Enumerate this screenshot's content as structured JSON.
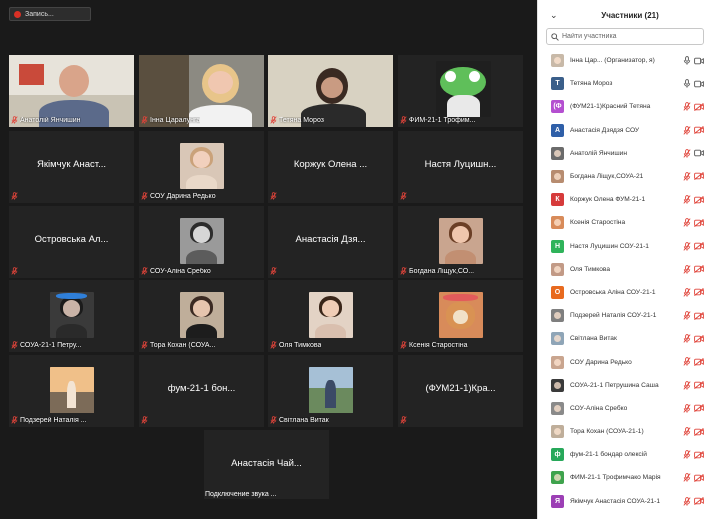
{
  "recording": {
    "label": "Запись..."
  },
  "tiles": [
    {
      "name": "Анатолій Янчишин",
      "center": "",
      "photo": "man",
      "bg": "#c9c3b4"
    },
    {
      "name": "Інна Царалунга",
      "center": "",
      "photo": "woman-blonde",
      "bg": "#8c8a82"
    },
    {
      "name": "Тетяна Мороз",
      "center": "",
      "photo": "woman-dark",
      "bg": "#b7b2a6",
      "active": true
    },
    {
      "name": "ФИМ-21-1 Трофим...",
      "center": "",
      "photo": "frog",
      "bg": "#1f1f1f"
    },
    {
      "name": "",
      "center": "Якімчук Анаст...",
      "photo": ""
    },
    {
      "name": "СОУ Дарина Редько",
      "center": "",
      "photo": "girl-light",
      "bg": "#d9c7b7"
    },
    {
      "name": "",
      "center": "Коржук Олена ...",
      "photo": ""
    },
    {
      "name": "",
      "center": "Настя Луцишн...",
      "photo": ""
    },
    {
      "name": "",
      "center": "Островська Ал...",
      "photo": ""
    },
    {
      "name": "СОУ-Аліна Сребко",
      "center": "",
      "photo": "girl-bw",
      "bg": "#9a9a9a"
    },
    {
      "name": "",
      "center": "Анастасія Дзя...",
      "photo": ""
    },
    {
      "name": "Богдана Ліщук,СО...",
      "center": "",
      "photo": "girl-brown",
      "bg": "#c9a58f"
    },
    {
      "name": "СОУА-21-1 Петру...",
      "center": "",
      "photo": "girl-crown",
      "bg": "#3a3a3a"
    },
    {
      "name": "Тора Кохан (СОУА...",
      "center": "",
      "photo": "girl-room",
      "bg": "#bfae9a"
    },
    {
      "name": "Оля Тимкова",
      "center": "",
      "photo": "girl-dark",
      "bg": "#e3d3c5"
    },
    {
      "name": "Ксенія Старостіна",
      "center": "",
      "photo": "dog",
      "bg": "#d88b5a"
    },
    {
      "name": "Подзерей Наталія ...",
      "center": "",
      "photo": "sunset",
      "bg": "#e2b07d"
    },
    {
      "name": "",
      "center": "фум-21-1 бон...",
      "photo": ""
    },
    {
      "name": "Світлана Витак",
      "center": "",
      "photo": "outdoor",
      "bg": "#8fa5b7"
    },
    {
      "name": "",
      "center": "(ФУМ21-1)Кра...",
      "photo": ""
    },
    {
      "name": "",
      "center": "Анастасія Чай...",
      "photo": ""
    }
  ],
  "connecting": "Подключение звука ...",
  "panel": {
    "collapse_icon": "chevron-down-icon",
    "title": "Участники (21)",
    "search_placeholder": "Найти участника",
    "participants": [
      {
        "name": "Інна Цар...  (Организатор, я)",
        "avatar": "photo",
        "avatar_color": "#c8b9a8",
        "muted": false,
        "video": "on"
      },
      {
        "name": "Тетяна Мороз",
        "avatar": "Т",
        "avatar_color": "#3b5f8a",
        "muted": false,
        "video": "on"
      },
      {
        "name": "(ФУМ21-1)Красний Тетяна",
        "avatar": "(Ф",
        "avatar_color": "#b44fd0",
        "muted": true,
        "video": "off"
      },
      {
        "name": "Анастасія Дзядзя СОУ",
        "avatar": "А",
        "avatar_color": "#2f5fa8",
        "muted": true,
        "video": "off"
      },
      {
        "name": "Анатолій Янчишин",
        "avatar": "photo",
        "avatar_color": "#6b6b6b",
        "muted": true,
        "video": "on"
      },
      {
        "name": "Богдана Ліщук,СОУА-21",
        "avatar": "photo",
        "avatar_color": "#b78c70",
        "muted": true,
        "video": "off"
      },
      {
        "name": "Коржук Олена ФУМ-21-1",
        "avatar": "К",
        "avatar_color": "#d63b3b",
        "muted": true,
        "video": "off"
      },
      {
        "name": "Ксенія Старостіна",
        "avatar": "photo",
        "avatar_color": "#d88b5a",
        "muted": true,
        "video": "off"
      },
      {
        "name": "Настя Луцишин СОУ-21-1",
        "avatar": "Н",
        "avatar_color": "#2fb35a",
        "muted": true,
        "video": "off"
      },
      {
        "name": "Оля Тимкова",
        "avatar": "photo",
        "avatar_color": "#c29a86",
        "muted": true,
        "video": "off"
      },
      {
        "name": "Островська Аліна СОУ-21-1",
        "avatar": "О",
        "avatar_color": "#e86a1f",
        "muted": true,
        "video": "off"
      },
      {
        "name": "Подзерей Наталія СОУ-21-1",
        "avatar": "photo",
        "avatar_color": "#7f7f7f",
        "muted": true,
        "video": "off"
      },
      {
        "name": "Світлана Витак",
        "avatar": "photo",
        "avatar_color": "#8fa5b7",
        "muted": true,
        "video": "off"
      },
      {
        "name": "СОУ Дарина Редько",
        "avatar": "photo",
        "avatar_color": "#c9a58f",
        "muted": true,
        "video": "off"
      },
      {
        "name": "СОУА-21-1 Петрушина Саша",
        "avatar": "photo",
        "avatar_color": "#3a3a3a",
        "muted": true,
        "video": "off"
      },
      {
        "name": "СОУ-Аліна Сребко",
        "avatar": "photo",
        "avatar_color": "#8a8a8a",
        "muted": true,
        "video": "off"
      },
      {
        "name": "Тора Кохан (СОУА-21-1)",
        "avatar": "photo",
        "avatar_color": "#bfae9a",
        "muted": true,
        "video": "off"
      },
      {
        "name": "фум-21-1 бондар олексій",
        "avatar": "ф",
        "avatar_color": "#27a85a",
        "muted": true,
        "video": "off"
      },
      {
        "name": "ФИМ-21-1 Трофимчако Марія",
        "avatar": "photo",
        "avatar_color": "#3fa34d",
        "muted": true,
        "video": "off"
      },
      {
        "name": "Якімчук Анастасія СОУА-21-1",
        "avatar": "Я",
        "avatar_color": "#9c3fb5",
        "muted": true,
        "video": "off"
      }
    ]
  },
  "colors": {
    "meeting_bg": "#1a1a1a",
    "tile_bg": "#232323",
    "active_speaker": "#b6e000",
    "muted_red": "#e0443a"
  }
}
